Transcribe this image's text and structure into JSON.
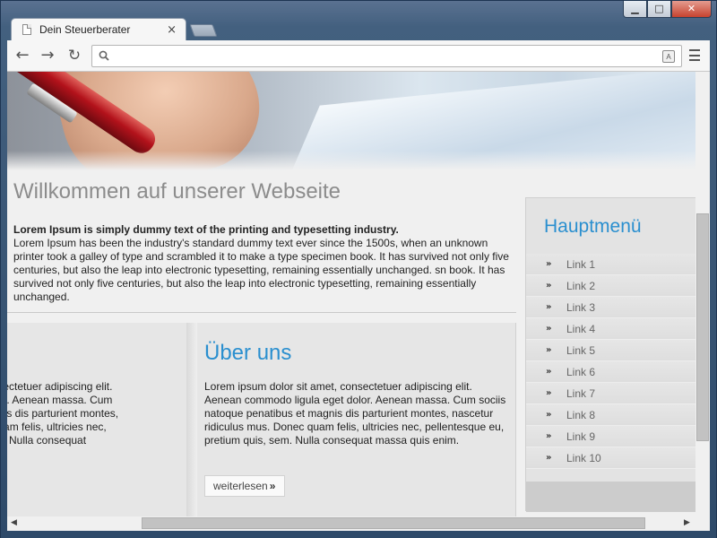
{
  "window": {
    "minimize_icon": "minimize-icon",
    "maximize_icon": "maximize-icon",
    "close_icon": "close-icon",
    "minimize_glyph": "▁",
    "maximize_glyph": "□",
    "close_glyph": "✕"
  },
  "tab": {
    "title": "Dein Steuerberater",
    "close_glyph": "×"
  },
  "toolbar": {
    "back_glyph": "←",
    "forward_glyph": "→",
    "reload_glyph": "↻",
    "address_value": "",
    "translate_glyph": "A"
  },
  "page": {
    "title": "Willkommen auf unserer Webseite",
    "intro_bold": "Lorem Ipsum is simply dummy text of the printing and typesetting industry.",
    "intro_body": "Lorem Ipsum has been the industry's standard dummy text ever since the 1500s, when an unknown printer took a galley of type and scrambled it to make a type specimen book. It has survived not only five centuries, but also the leap into electronic typesetting, remaining essentially unchanged. sn book. It has survived not only five centuries, but also the leap into electronic typesetting, remaining essentially unchanged.",
    "left_box_lines": [
      "t, consectetuer adipiscing elit.",
      "et dolor. Aenean massa. Cum",
      "t magnis dis parturient montes,",
      "nec quam felis, ultricies nec,",
      "s, sem. Nulla consequat"
    ],
    "about": {
      "title": "Über uns",
      "text": "Lorem ipsum dolor sit amet, consectetuer adipiscing elit. Aenean commodo ligula eget dolor. Aenean massa. Cum sociis natoque penatibus et magnis dis parturient montes, nascetur ridiculus mus. Donec quam felis, ultricies nec, pellentesque eu, pretium quis, sem. Nulla consequat massa quis enim.",
      "more_label": "weiterlesen",
      "more_chevron": "»"
    }
  },
  "sidebar": {
    "title": "Hauptmenü",
    "arrow_glyph": "»",
    "items": [
      "Link 1",
      "Link 2",
      "Link 3",
      "Link 4",
      "Link 5",
      "Link 6",
      "Link 7",
      "Link 8",
      "Link 9",
      "Link 10"
    ]
  },
  "scrollbars": {
    "left_arrow": "◀",
    "right_arrow": "▶"
  }
}
